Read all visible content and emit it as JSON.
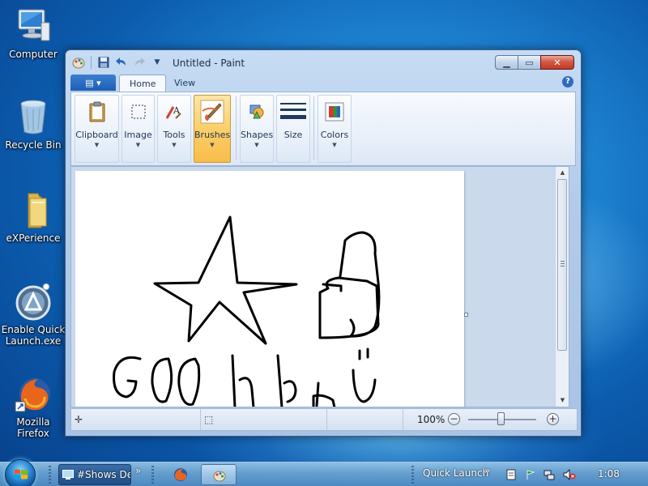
{
  "desktop": {
    "icons": [
      {
        "label": "Computer"
      },
      {
        "label": "Recycle Bin"
      },
      {
        "label": "eXPerience"
      },
      {
        "label": "Enable Quick Launch.exe"
      },
      {
        "label": "Mozilla Firefox"
      }
    ]
  },
  "window": {
    "title": "Untitled - Paint",
    "app_menu_icon": "app-menu-icon",
    "tabs": [
      {
        "label": "Home"
      },
      {
        "label": "View"
      }
    ],
    "ribbon_groups": [
      {
        "label": "Clipboard",
        "icon": "clipboard-icon"
      },
      {
        "label": "Image",
        "icon": "image-select-icon"
      },
      {
        "label": "Tools",
        "icon": "tools-icon"
      },
      {
        "label": "Brushes",
        "icon": "brush-icon",
        "selected": true
      },
      {
        "label": "Shapes",
        "icon": "shapes-icon"
      },
      {
        "label": "Size",
        "icon": "size-icon"
      },
      {
        "label": "Colors",
        "icon": "colors-icon"
      }
    ],
    "status": {
      "zoom": "100%"
    }
  },
  "taskbar": {
    "items": [
      {
        "label": "#Shows Desktop"
      }
    ],
    "quick_launch_label": "Quick Launch",
    "clock": "1:08"
  },
  "colors": {
    "accent": "#1f86d4",
    "selected_group": "#fbcf6a",
    "close_button": "#c0392a"
  }
}
